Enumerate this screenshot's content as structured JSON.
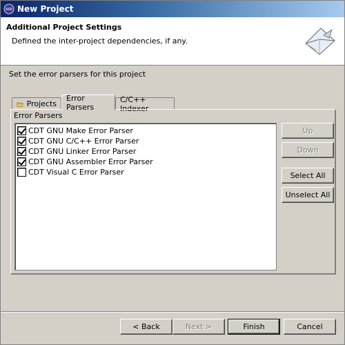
{
  "window": {
    "title": "New Project",
    "title_bar_color": "#0a246a"
  },
  "header": {
    "heading": "Additional Project Settings",
    "description": "Defined the inter-project dependencies, if any.",
    "icon": "wizard-envelope-icon"
  },
  "instruction": "Set the error parsers for this project",
  "tabs": [
    {
      "label": "Projects",
      "icon": "folder-icon",
      "active": false
    },
    {
      "label": "Error Parsers",
      "active": true
    },
    {
      "label": "C/C++ Indexer",
      "active": false
    }
  ],
  "error_parsers": {
    "group_label": "Error Parsers",
    "items": [
      {
        "label": "CDT GNU Make Error Parser",
        "checked": true
      },
      {
        "label": "CDT GNU C/C++ Error Parser",
        "checked": true
      },
      {
        "label": "CDT GNU Linker Error Parser",
        "checked": true
      },
      {
        "label": "CDT GNU Assembler Error Parser",
        "checked": true
      },
      {
        "label": "CDT Visual C Error Parser",
        "checked": false
      }
    ]
  },
  "side_buttons": {
    "up": "Up",
    "down": "Down",
    "select_all": "Select All",
    "unselect_all": "Unselect All"
  },
  "footer": {
    "back": "< Back",
    "next": "Next >",
    "finish": "Finish",
    "cancel": "Cancel"
  }
}
